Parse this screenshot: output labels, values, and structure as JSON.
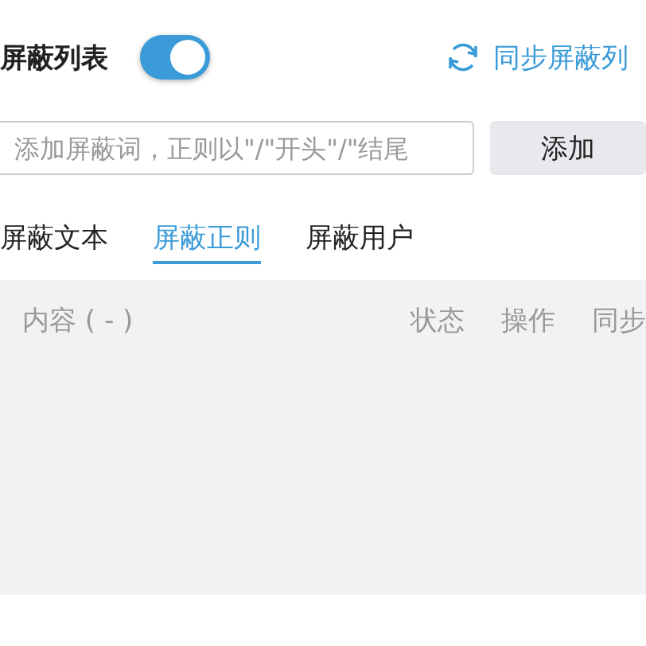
{
  "header": {
    "title": "屏蔽列表",
    "toggle": {
      "on": true
    },
    "sync_link": "同步屏蔽列"
  },
  "input": {
    "placeholder": "添加屏蔽词，正则以\"/\"开头\"/\"结尾",
    "button": "添加"
  },
  "tabs": [
    {
      "label": "屏蔽文本",
      "selected": false
    },
    {
      "label": "屏蔽正则",
      "selected": true
    },
    {
      "label": "屏蔽用户",
      "selected": false
    }
  ],
  "table": {
    "columns": [
      "内容 ( - )",
      "状态",
      "操作",
      "同步"
    ]
  }
}
